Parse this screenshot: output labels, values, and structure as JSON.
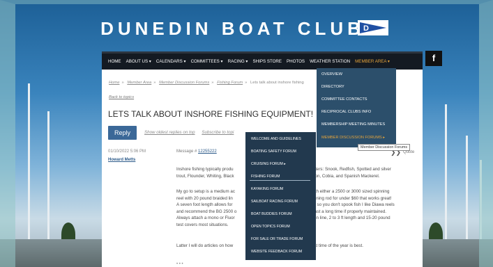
{
  "site": {
    "title": "DUNEDIN BOAT CLUB"
  },
  "colors": {
    "nav_bg": "#141a22",
    "active": "#e6a43b",
    "dropdown_bg": "#2c4f6b",
    "submenu_bg": "#22394e",
    "button": "#3b6898",
    "link": "#2d5b8a"
  },
  "nav": {
    "items": [
      "HOME",
      "ABOUT US ▾",
      "CALENDARS ▾",
      "COMMITTEES ▾",
      "RACING ▾",
      "SHIPS STORE",
      "PHOTOS",
      "WEATHER STATION",
      "MEMBER AREA ▾"
    ],
    "social_icon": "f"
  },
  "breadcrumb": {
    "home": "Home",
    "member_area": "Member Area",
    "discussion_forums": "Member Discussion Forums",
    "fishing_forum": "Fishing Forum",
    "current": "Lets talk about inshore fishing"
  },
  "page": {
    "back_link": "Back to topics",
    "title": "LETS TALK ABOUT INSHORE FISHING EQUIPMENT!",
    "reply_label": "Reply",
    "show_oldest": "Show oldest replies on top",
    "subscribe": "Subscribe to topi"
  },
  "post": {
    "date": "01/10/2022 5:06 PM",
    "author": "Howard Metts",
    "message_label": "Message #",
    "message_id": "12255222",
    "quote_label": "Quote",
    "para1": [
      "Inshore fishing typically produ",
      "trout, Flounder, Whiting, Black"
    ],
    "para1_right": [
      "r waters:  Snook, Redfish, Spotted and silver",
      "Tarpon, Cobia, and Spanish Mackerel."
    ],
    "para2": [
      "My go to setup is a medium ac",
      "reel with 20 pound braided lin",
      "A seven foot length allows for",
      "and recommend the BG 2500 o",
      "Always attach a mono or Fluor",
      "test covers most situations."
    ],
    "para2_right": [
      "with either a 2500 or 3000 sized spinning",
      "spinning rod for under $60 that works great!",
      "ded so you don't spook fish I like Diawa reels",
      "ll last a long time if properly maintained.",
      "main line, 2 to 3 ft length and 15-20 pound",
      ""
    ],
    "para3_left": "Latter I will do articles on how",
    "para3_right": "what time of the year is best.",
    "trailing": "• • •"
  },
  "member_menu": {
    "items": [
      "OVERVIEW",
      "DIRECTORY",
      "COMMITTEE CONTACTS",
      "RECIPROCAL CLUBS INFO",
      "MEMBERSHIP MEETING MINUTES",
      "MEMBER DISCUSSION FORUMS ▸"
    ],
    "tooltip": "Member Discussion Forums"
  },
  "forums_menu": {
    "items": [
      "WELCOME AND GUIDELINES",
      "BOATING SAFETY FORUM",
      "CRUISING FORUM ▸",
      "FISHING FORUM",
      "KAYAKING FORUM",
      "SAILBOAT RACING FORUM",
      "BOAT BUDDIES FORUM",
      "OPEN TOPICS FORUM",
      "FOR SALE OR TRADE FORUM",
      "WEBSITE FEEDBACK FORUM"
    ]
  }
}
